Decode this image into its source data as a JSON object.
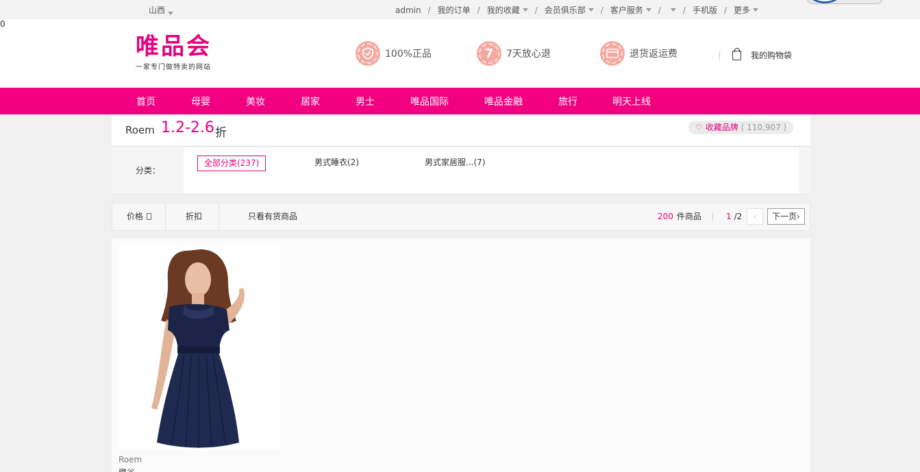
{
  "topbar": {
    "region": "山西",
    "nav": [
      {
        "label": "admin",
        "caret": false
      },
      {
        "label": "我的订单",
        "caret": false
      },
      {
        "label": "我的收藏",
        "caret": true
      },
      {
        "label": "会员俱乐部",
        "caret": true
      },
      {
        "label": "客户服务",
        "caret": true
      },
      {
        "label": "",
        "caret": true
      },
      {
        "label": "手机版",
        "caret": false
      },
      {
        "label": "更多",
        "caret": true
      }
    ]
  },
  "header": {
    "logo_text": "唯品会",
    "logo_slogan": "一家专门做特卖的网站",
    "promises": [
      {
        "icon": "shield-icon",
        "badge": "",
        "label": "100%正品"
      },
      {
        "icon": "seven-days-icon",
        "badge": "7",
        "label": "7天放心退"
      },
      {
        "icon": "card-icon",
        "badge": "",
        "label": "退货返运费"
      }
    ],
    "cart_count": "0",
    "cart_label": "我的购物袋"
  },
  "main_nav": [
    "首页",
    "母婴",
    "美妆",
    "居家",
    "男士",
    "唯品国际",
    "唯品金融",
    "旅行",
    "明天上线"
  ],
  "brand": {
    "name": "Roem",
    "discount": "1.2-2.6",
    "discount_unit": "折",
    "favorite_label": "收藏品牌",
    "favorite_count": "( 110,907 )"
  },
  "category": {
    "label": "分类：",
    "options": [
      {
        "label": "全部分类(237)",
        "active": true
      },
      {
        "label": "男式睡衣(2)",
        "active": false
      },
      {
        "label": "男式家居服...(7)",
        "active": false
      }
    ]
  },
  "sort": {
    "price_label": "价格",
    "discount_label": "折扣",
    "in_stock_label": "只看有货商品",
    "total_count": "200",
    "total_unit": "件商品",
    "page_current": "1",
    "page_total": "/2",
    "prev_label": "‹",
    "next_label": "下一页›"
  },
  "products": [
    {
      "brand": "Roem",
      "title": "璐谷",
      "image": "woman-in-navy-dress-photo"
    }
  ],
  "colors": {
    "accent": "#e4007f",
    "nav_bg": "#f10180"
  }
}
